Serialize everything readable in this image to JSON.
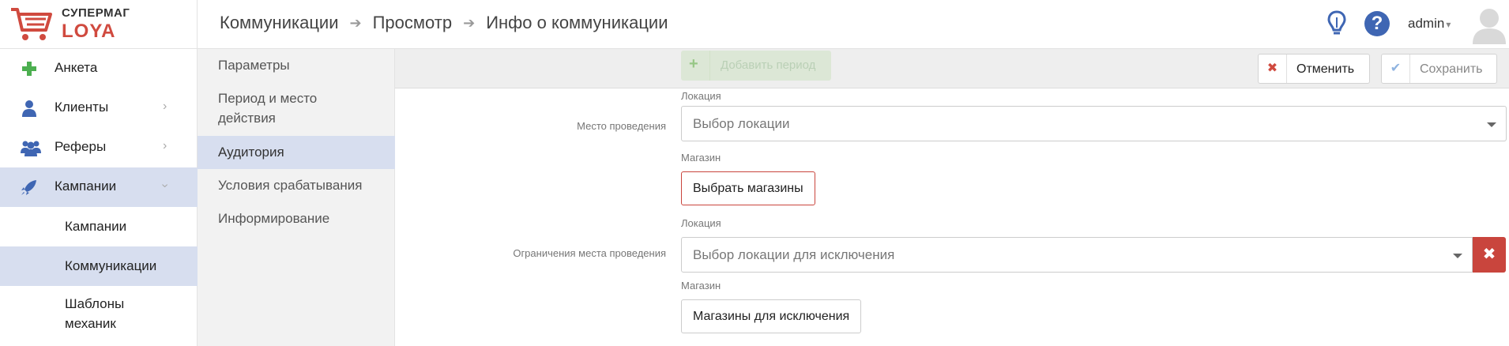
{
  "brand": {
    "line1": "СУПЕРМАГ",
    "line2": "LOYA"
  },
  "breadcrumbs": [
    "Коммуникации",
    "Просмотр",
    "Инфо о коммуникации"
  ],
  "header": {
    "user": "admin",
    "help": "?"
  },
  "sidebar": {
    "items": [
      {
        "label": "Анкета",
        "icon": "plus-icon"
      },
      {
        "label": "Клиенты",
        "icon": "user-icon"
      },
      {
        "label": "Реферы",
        "icon": "users-icon"
      },
      {
        "label": "Кампании",
        "icon": "rocket-icon"
      }
    ],
    "subitems": [
      "Кампании",
      "Коммуникации",
      "Шаблоны механик"
    ]
  },
  "sections": [
    "Параметры",
    "Период и место действия",
    "Аудитория",
    "Условия срабатывания",
    "Информирование"
  ],
  "toolbar": {
    "add_period": "Добавить период",
    "cancel": "Отменить",
    "save": "Сохранить"
  },
  "form": {
    "venue": {
      "label": "Место проведения",
      "location_caption": "Локация",
      "location_placeholder": "Выбор локации",
      "store_caption": "Магазин",
      "store_button": "Выбрать магазины"
    },
    "venue_limits": {
      "label": "Ограничения места проведения",
      "location_caption": "Локация",
      "location_placeholder": "Выбор локации для исключения",
      "store_caption": "Магазин",
      "store_button": "Магазины для исключения",
      "remove": "✖"
    }
  },
  "colors": {
    "accent": "#3f66b3",
    "danger": "#c9453d",
    "active_bg": "#d7deef"
  }
}
